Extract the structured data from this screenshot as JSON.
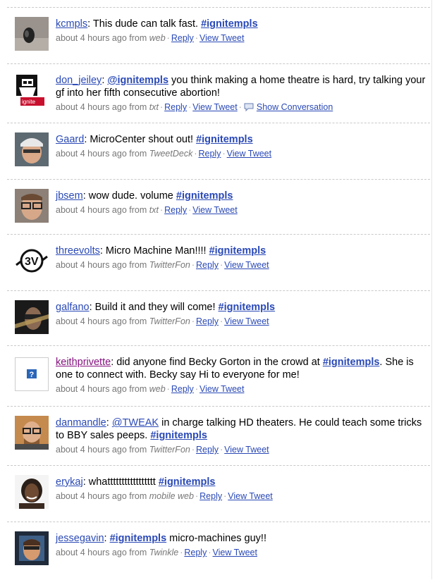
{
  "meta_labels": {
    "reply": "Reply",
    "view_tweet": "View Tweet",
    "show_conversation": "Show Conversation",
    "dot": "·"
  },
  "tweets": [
    {
      "user": "kcmpls",
      "parts": [
        {
          "t": "text",
          "v": ": This dude can talk fast. "
        },
        {
          "t": "hashtag",
          "v": "#ignitempls"
        }
      ],
      "time": "about 4 hours ago from",
      "source": "web"
    },
    {
      "user": "don_jeiley",
      "parts": [
        {
          "t": "text",
          "v": ": "
        },
        {
          "t": "hashtag",
          "v": "@ignitempls"
        },
        {
          "t": "text",
          "v": " you think making a home theatre is hard, try talking your gf into her fifth consecutive abortion!"
        }
      ],
      "time": "about 4 hours ago from",
      "source": "txt",
      "conversation": true
    },
    {
      "user": "Gaard",
      "parts": [
        {
          "t": "text",
          "v": ": MicroCenter shout out! "
        },
        {
          "t": "hashtag",
          "v": "#ignitempls"
        }
      ],
      "time": "about 4 hours ago from",
      "source": "TweetDeck"
    },
    {
      "user": "jbsem",
      "parts": [
        {
          "t": "text",
          "v": ": wow dude. volume "
        },
        {
          "t": "hashtag",
          "v": "#ignitempls"
        }
      ],
      "time": "about 4 hours ago from",
      "source": "txt"
    },
    {
      "user": "threevolts",
      "parts": [
        {
          "t": "text",
          "v": ": Micro Machine Man!!!! "
        },
        {
          "t": "hashtag",
          "v": "#ignitempls"
        }
      ],
      "time": "about 4 hours ago from",
      "source": "TwitterFon"
    },
    {
      "user": "galfano",
      "parts": [
        {
          "t": "text",
          "v": ": Build it and they will come! "
        },
        {
          "t": "hashtag",
          "v": "#ignitempls"
        }
      ],
      "time": "about 4 hours ago from",
      "source": "TwitterFon"
    },
    {
      "user": "keithprivette",
      "visited": true,
      "parts": [
        {
          "t": "text",
          "v": ": did anyone find Becky Gorton in the crowd at "
        },
        {
          "t": "hashtag",
          "v": "#ignitempls"
        },
        {
          "t": "text",
          "v": ". She is one to connect with. Becky say Hi to everyone for me!"
        }
      ],
      "time": "about 4 hours ago from",
      "source": "web"
    },
    {
      "user": "danmandle",
      "parts": [
        {
          "t": "text",
          "v": ": "
        },
        {
          "t": "mention",
          "v": "@TWEAK"
        },
        {
          "t": "text",
          "v": " in charge talking HD theaters. He could teach some tricks to BBY sales peeps. "
        },
        {
          "t": "hashtag",
          "v": "#ignitempls"
        }
      ],
      "time": "about 4 hours ago from",
      "source": "TwitterFon"
    },
    {
      "user": "erykaj",
      "parts": [
        {
          "t": "text",
          "v": ": whattttttttttttttttt "
        },
        {
          "t": "hashtag",
          "v": "#ignitempls"
        }
      ],
      "time": "about 4 hours ago from",
      "source": "mobile web"
    },
    {
      "user": "jessegavin",
      "parts": [
        {
          "t": "text",
          "v": ": "
        },
        {
          "t": "hashtag",
          "v": "#ignitempls"
        },
        {
          "t": "text",
          "v": " micro-machines guy!!"
        }
      ],
      "time": "about 4 hours ago from",
      "source": "Twinkle"
    }
  ]
}
